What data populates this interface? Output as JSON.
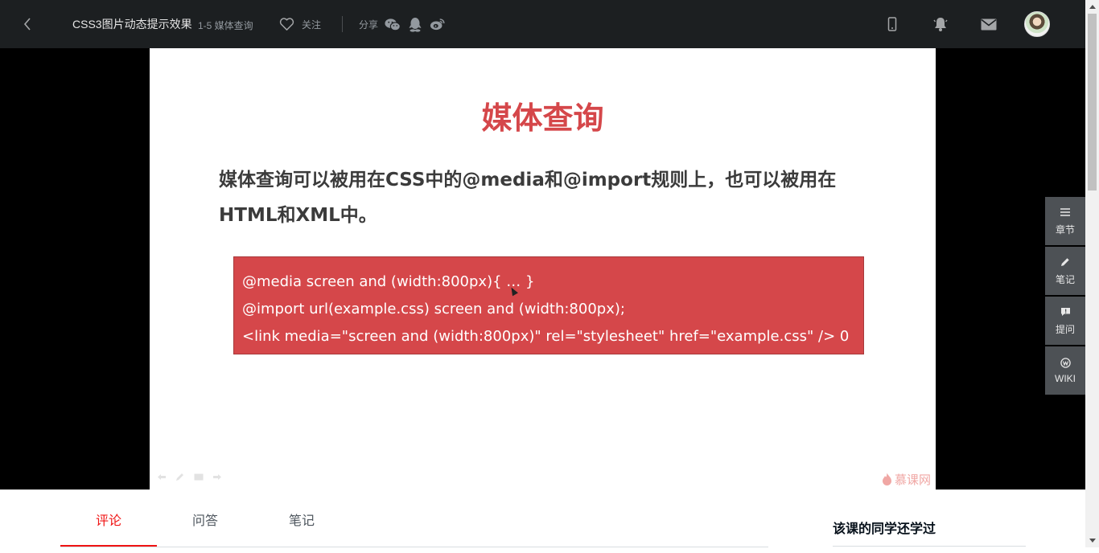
{
  "header": {
    "course_title": "CSS3图片动态提示效果",
    "lesson_title": "1-5 媒体查询",
    "follow_label": "关注",
    "share_label": "分享",
    "icons": [
      "back-icon",
      "heart-icon",
      "wechat-icon",
      "qq-icon",
      "weibo-icon",
      "mobile-icon",
      "bell-icon",
      "mail-icon",
      "avatar"
    ]
  },
  "slide": {
    "title": "媒体查询",
    "description": "媒体查询可以被用在CSS中的@media和@import规则上，也可以被用在HTML和XML中。",
    "code_lines": [
      "@media screen and (width:800px){ … }",
      "@import url(example.css) screen and (width:800px);",
      " <link media=\"screen and (width:800px)\" rel=\"stylesheet\" href=\"example.css\" /> 0"
    ],
    "watermark": "慕课网",
    "title_color": "#d5474a",
    "code_bg_color": "#d5474a"
  },
  "sidebar": {
    "items": [
      {
        "label": "章节",
        "icon": "menu-icon"
      },
      {
        "label": "笔记",
        "icon": "pencil-icon"
      },
      {
        "label": "提问",
        "icon": "question-icon"
      },
      {
        "label": "WIKI",
        "icon": "wiki-icon"
      }
    ]
  },
  "tabs": {
    "items": [
      "评论",
      "问答",
      "笔记"
    ],
    "active": "评论",
    "active_color": "#f01414"
  },
  "related": {
    "title": "该课的同学还学过"
  }
}
